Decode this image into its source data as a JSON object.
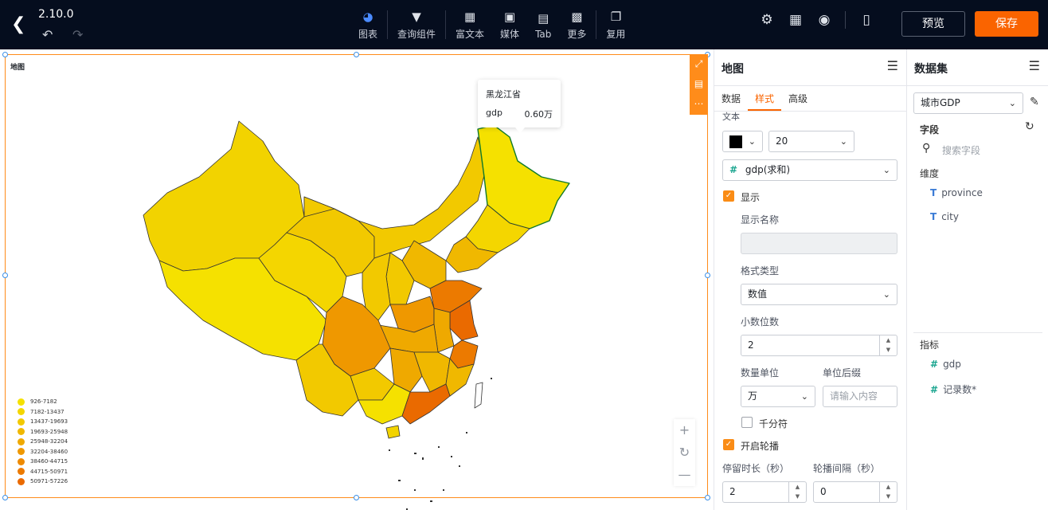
{
  "header": {
    "version": "2.10.0",
    "preview_label": "预览",
    "save_label": "保存"
  },
  "toolbar": {
    "items": [
      {
        "label": "图表",
        "icon": "pie-chart-icon"
      },
      {
        "label": "查询组件",
        "icon": "filter-icon"
      },
      {
        "label": "富文本",
        "icon": "text-icon"
      },
      {
        "label": "媒体",
        "icon": "image-icon"
      },
      {
        "label": "Tab",
        "icon": "tab-icon"
      },
      {
        "label": "更多",
        "icon": "grid-icon"
      },
      {
        "label": "复用",
        "icon": "copy-icon"
      }
    ]
  },
  "chart": {
    "title": "地图",
    "tooltip": {
      "region": "黑龙江省",
      "field": "gdp",
      "value": "0.60万"
    },
    "legend": [
      {
        "label": "926-7182",
        "color": "#f5e100"
      },
      {
        "label": "7182-13437",
        "color": "#f4d600"
      },
      {
        "label": "13437-19693",
        "color": "#f2c900"
      },
      {
        "label": "19693-25948",
        "color": "#f0b800"
      },
      {
        "label": "25948-32204",
        "color": "#efa900"
      },
      {
        "label": "32204-38460",
        "color": "#ef9800"
      },
      {
        "label": "38460-44715",
        "color": "#ee8a00"
      },
      {
        "label": "44715-50971",
        "color": "#ec7a00"
      },
      {
        "label": "50971-57226",
        "color": "#ea6a00"
      }
    ]
  },
  "style_panel": {
    "title": "地图",
    "tabs": [
      "数据",
      "样式",
      "高级"
    ],
    "active_tab": "样式",
    "section_label": "文本",
    "font_color": "#000000",
    "font_size": "20",
    "field_select": "gdp(求和)",
    "show_label": "显示",
    "display_name_label": "显示名称",
    "format_type_label": "格式类型",
    "format_type_value": "数值",
    "decimal_label": "小数位数",
    "decimal_value": "2",
    "unit_label": "数量单位",
    "unit_value": "万",
    "suffix_label": "单位后缀",
    "suffix_placeholder": "请输入内容",
    "thousands_label": "千分符",
    "carousel_label": "开启轮播",
    "dwell_label": "停留时长（秒）",
    "dwell_value": "2",
    "interval_label": "轮播间隔（秒）",
    "interval_value": "0"
  },
  "dataset_panel": {
    "title": "数据集",
    "dataset": "城市GDP",
    "fields_label": "字段",
    "search_placeholder": "搜索字段",
    "dimension_label": "维度",
    "dimensions": [
      "province",
      "city"
    ],
    "metric_label": "指标",
    "metrics": [
      "gdp",
      "记录数*"
    ]
  }
}
